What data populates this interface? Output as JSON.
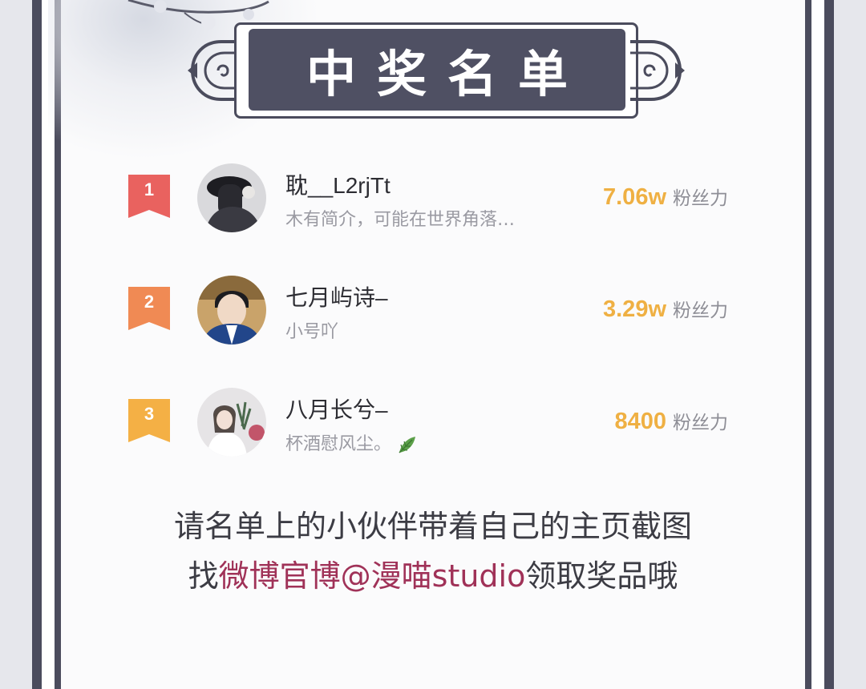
{
  "title": "中奖名单",
  "colors": {
    "frame": "#4b4c5d",
    "plaque": "#4f5063",
    "fans_value": "#efb043",
    "highlight": "#a03258",
    "rank_1": "#e9625f",
    "rank_2": "#f08a54",
    "rank_3": "#f4b045"
  },
  "winners": [
    {
      "rank": "1",
      "name": "耽__L2rjTt",
      "bio": "木有简介，可能在世界角落…",
      "fans_value": "7.06w",
      "fans_label": "粉丝力",
      "avatar_icon": "avatar-photo-hat"
    },
    {
      "rank": "2",
      "name": "七月屿诗–",
      "bio": "小号吖",
      "fans_value": "3.29w",
      "fans_label": "粉丝力",
      "avatar_icon": "avatar-photo-man"
    },
    {
      "rank": "3",
      "name": "八月长兮–",
      "bio": "杯酒慰风尘。",
      "fans_value": "8400",
      "fans_label": "粉丝力",
      "avatar_icon": "avatar-photo-woman",
      "bio_emoji": "leaf-icon"
    }
  ],
  "notice": {
    "line1": "请名单上的小伙伴带着自己的主页截图",
    "line2_prefix": "找",
    "line2_highlight": "微博官博@漫喵studio",
    "line2_suffix": "领取奖品哦"
  }
}
